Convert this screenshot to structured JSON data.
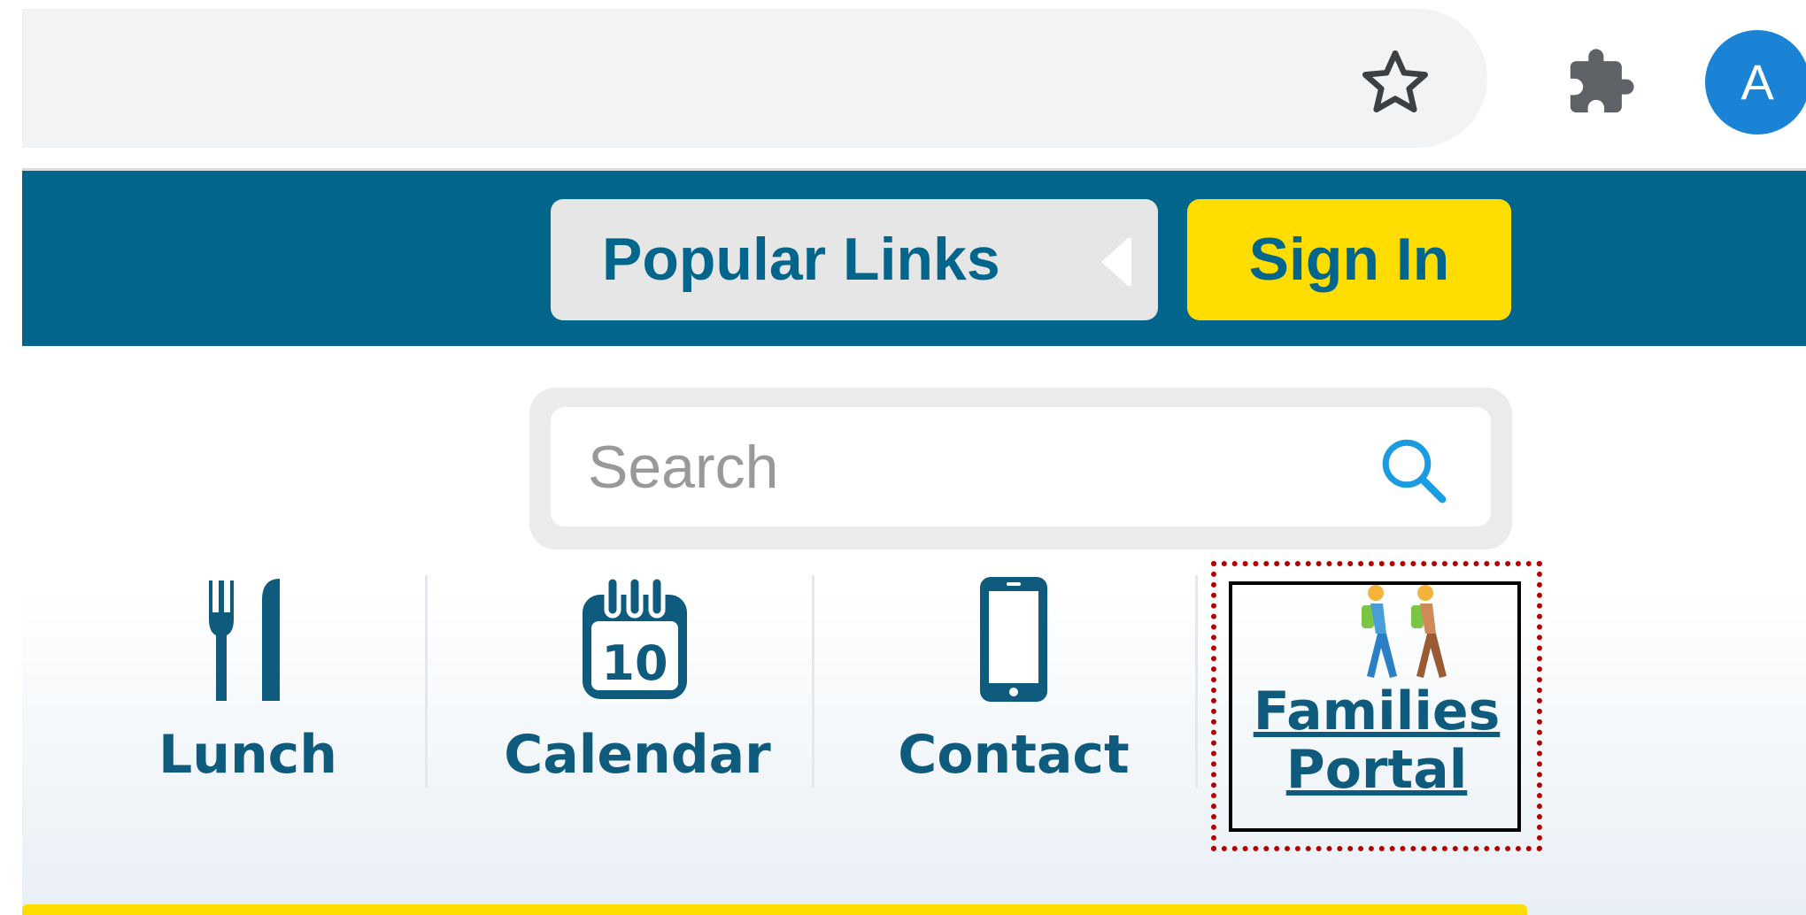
{
  "browser": {
    "bookmark_icon": "star-outline-icon",
    "extensions_icon": "puzzle-piece-icon",
    "profile_initial": "A",
    "profile_color": "#1a83d6"
  },
  "header": {
    "popular_links_label": "Popular Links",
    "sign_in_label": "Sign In",
    "bar_color": "#02668c",
    "accent_color": "#ffdd00"
  },
  "search": {
    "placeholder": "Search",
    "value": "",
    "icon": "magnifier-icon"
  },
  "quick_links": [
    {
      "label": "Lunch",
      "icon": "fork-knife-icon"
    },
    {
      "label": "Calendar",
      "icon": "calendar-icon",
      "day": "10"
    },
    {
      "label": "Contact",
      "icon": "mobile-phone-icon"
    },
    {
      "label_line1": "Families",
      "label_line2": "Portal",
      "icon": "walking-people-icon"
    }
  ]
}
